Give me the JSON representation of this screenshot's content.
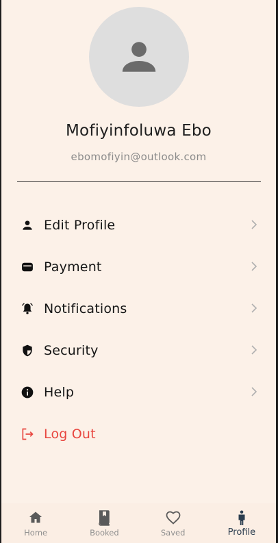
{
  "profile": {
    "name": "Mofiyinfoluwa Ebo",
    "email": "ebomofiyin@outlook.com"
  },
  "menu": {
    "items": [
      {
        "label": "Edit Profile",
        "icon": "person-icon"
      },
      {
        "label": "Payment",
        "icon": "wallet-icon"
      },
      {
        "label": "Notifications",
        "icon": "bell-icon"
      },
      {
        "label": "Security",
        "icon": "shield-icon"
      },
      {
        "label": "Help",
        "icon": "info-icon"
      }
    ],
    "logout": {
      "label": "Log Out",
      "icon": "logout-icon",
      "color": "#e8463f"
    }
  },
  "nav": {
    "items": [
      {
        "label": "Home",
        "icon": "home-icon"
      },
      {
        "label": "Booked",
        "icon": "book-icon"
      },
      {
        "label": "Saved",
        "icon": "heart-icon"
      },
      {
        "label": "Profile",
        "icon": "person-standing-icon",
        "active": true
      }
    ]
  },
  "colors": {
    "background": "#fcf1e8",
    "accent": "#2b3d4f",
    "logout": "#e8463f"
  }
}
